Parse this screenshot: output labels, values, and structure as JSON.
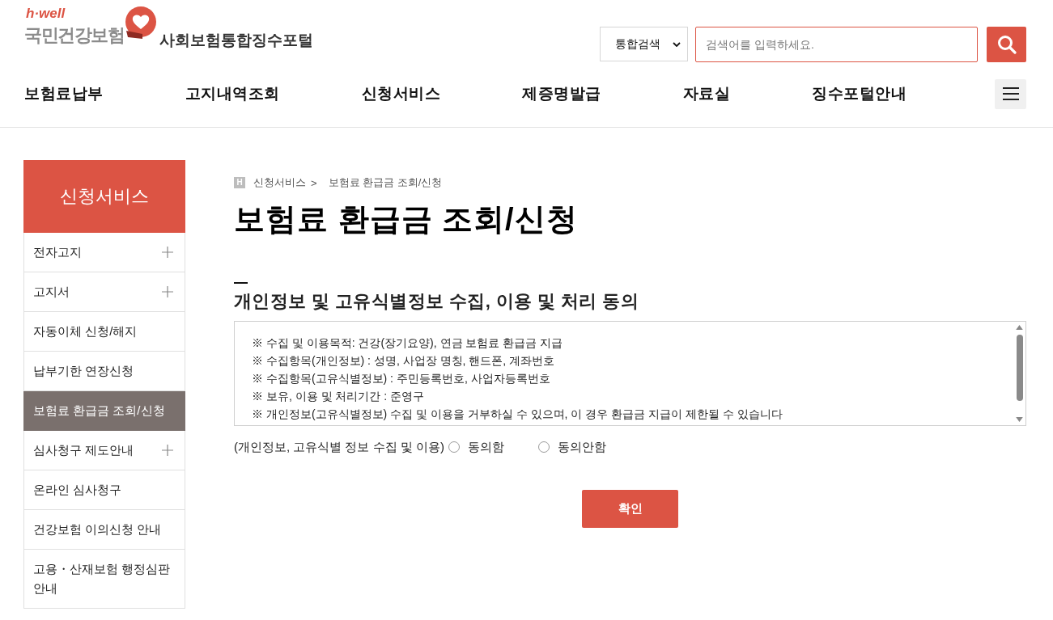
{
  "header": {
    "logo": {
      "tagline": "h·well",
      "name": "국민건강보험"
    },
    "portal_title": "사회보험통합징수포털",
    "search": {
      "scope": "통합검색",
      "placeholder": "검색어를 입력하세요."
    }
  },
  "nav": {
    "items": [
      "보험료납부",
      "고지내역조회",
      "신청서비스",
      "제증명발급",
      "자료실",
      "징수포털안내"
    ]
  },
  "sidebar": {
    "title": "신청서비스",
    "items": [
      {
        "label": "전자고지",
        "expandable": true,
        "selected": false
      },
      {
        "label": "고지서",
        "expandable": true,
        "selected": false
      },
      {
        "label": "자동이체 신청/해지",
        "expandable": false,
        "selected": false
      },
      {
        "label": "납부기한 연장신청",
        "expandable": false,
        "selected": false
      },
      {
        "label": "보험료 환급금 조회/신청",
        "expandable": false,
        "selected": true
      },
      {
        "label": "심사청구 제도안내",
        "expandable": true,
        "selected": false
      },
      {
        "label": "온라인 심사청구",
        "expandable": false,
        "selected": false
      },
      {
        "label": "건강보험 이의신청 안내",
        "expandable": false,
        "selected": false
      },
      {
        "label": "고용・산재보험 행정심판 안내",
        "expandable": false,
        "selected": false
      }
    ]
  },
  "breadcrumb": {
    "home_label": "H",
    "items": [
      {
        "kind": "link",
        "text": "신청서비스"
      },
      {
        "kind": "separator",
        "text": ">"
      },
      {
        "kind": "current",
        "text": "보험료 환급금 조회/신청"
      }
    ]
  },
  "page_title": "보험료 환급금 조회/신청",
  "consent": {
    "heading": "개인정보 및 고유식별정보 수집, 이용 및 처리 동의",
    "lines": [
      "※ 수집 및 이용목적: 건강(장기요양), 연금 보험료 환급금 지급",
      "※ 수집항목(개인정보) : 성명, 사업장 명칭, 핸드폰, 계좌번호",
      "※ 수집항목(고유식별정보) : 주민등록번호, 사업자등록번호",
      "※ 보유, 이용 및 처리기간 : 준영구",
      "※ 개인정보(고유식별정보) 수집 및 이용을 거부하실 수 있으며, 이 경우 환급금 지급이 제한될 수 있습니다"
    ],
    "question": "(개인정보, 고유식별 정보 수집 및 이용)",
    "options": [
      {
        "label": "동의함",
        "selected": false
      },
      {
        "label": "동의안함",
        "selected": false
      }
    ]
  },
  "confirm_button": "확인"
}
